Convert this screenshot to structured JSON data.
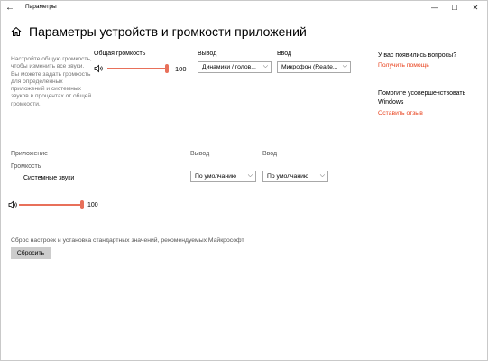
{
  "titlebar": {
    "app_title": "Параметры",
    "back_glyph": "←",
    "minimize_glyph": "—",
    "maximize_glyph": "☐",
    "close_glyph": "✕"
  },
  "page": {
    "title": "Параметры устройств и громкости приложений",
    "home_icon": "home-icon"
  },
  "description": "Настройте общую громкость, чтобы изменить все звуки. Вы можете задать громкость для определенных приложений и системных звуков в процентах от общей громкости.",
  "master": {
    "label": "Общая громкость",
    "volume_value": "100",
    "volume_fraction": 1.0,
    "output_label": "Вывод",
    "output_value": "Динамики / голов...",
    "input_label": "Ввод",
    "input_value": "Микрофон (Realte..."
  },
  "apps": {
    "app_header": "Приложение",
    "volume_header": "Громкость",
    "output_header": "Вывод",
    "input_header": "Ввод",
    "items": [
      {
        "name": "Системные звуки",
        "volume_value": "100",
        "volume_fraction": 1.0,
        "output_value": "По умолчанию",
        "input_value": "По умолчанию"
      }
    ]
  },
  "help": {
    "question": "У вас появились вопросы?",
    "get_help": "Получить помощь",
    "improve": "Помогите усовершенствовать Windows",
    "feedback": "Оставить отзыв"
  },
  "reset": {
    "description": "Сброс настроек и установка стандартных значений, рекомендуемых Майкрософт.",
    "button": "Сбросить"
  },
  "colors": {
    "accent": "#e8705a",
    "link": "#e8411c"
  },
  "icons": {
    "chevron": "⌵"
  }
}
